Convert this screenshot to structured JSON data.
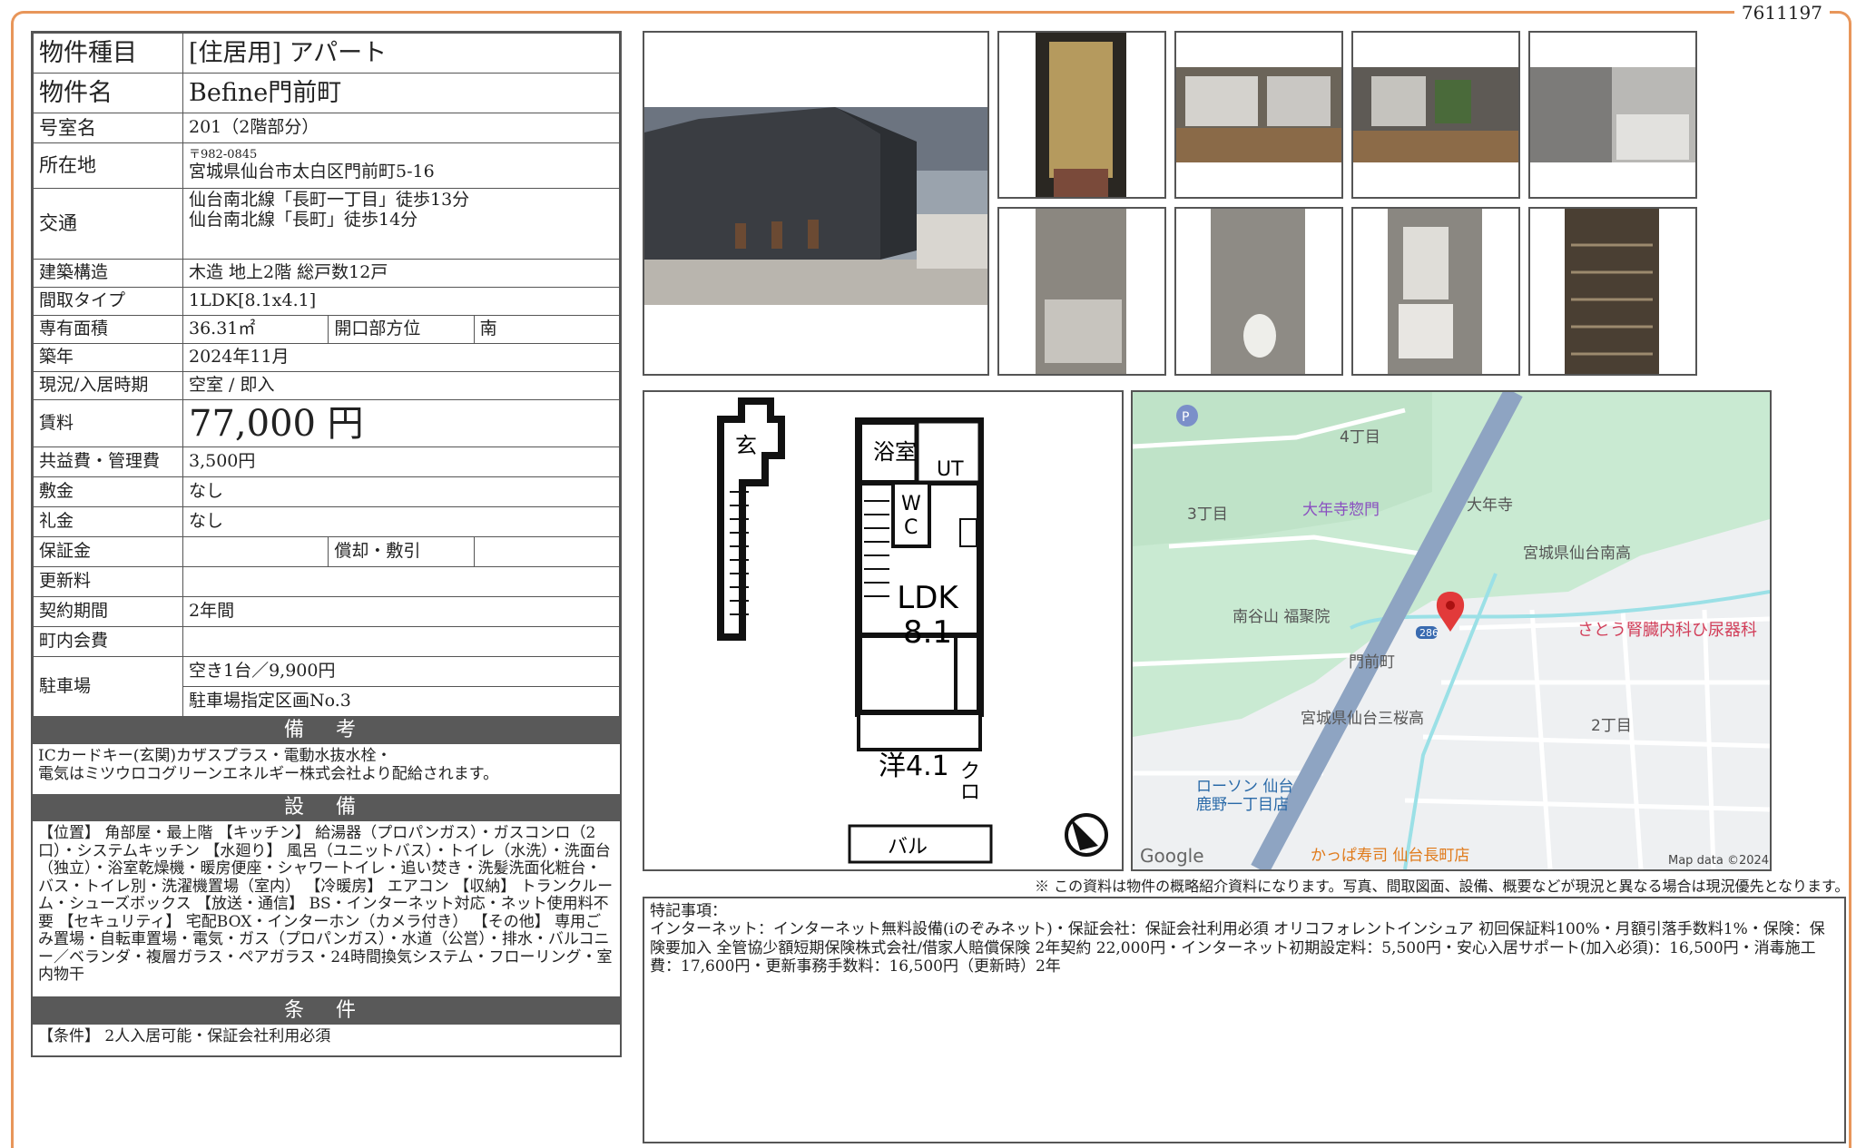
{
  "doc_id": "7611197",
  "property": {
    "type_label": "物件種目",
    "type_value": "[住居用] アパート",
    "name_label": "物件名",
    "name_value": "Befine門前町",
    "room_label": "号室名",
    "room_value": "201（2階部分）",
    "address_label": "所在地",
    "postal": "〒982-0845",
    "address": "宮城県仙台市太白区門前町5-16",
    "transit_label": "交通",
    "transit_1": "仙台南北線「長町一丁目」徒歩13分",
    "transit_2": "仙台南北線「長町」徒歩14分",
    "structure_label": "建築構造",
    "structure_value": "木造 地上2階 総戸数12戸",
    "layout_label": "間取タイプ",
    "layout_value": "1LDK[8.1x4.1]",
    "area_label": "専有面積",
    "area_value": "36.31㎡",
    "direction_label": "開口部方位",
    "direction_value": "南",
    "built_label": "築年",
    "built_value": "2024年11月",
    "status_label": "現況/入居時期",
    "status_value": "空室 / 即入",
    "rent_label": "賃料",
    "rent_value": "77,000 円",
    "fee_label": "共益費・管理費",
    "fee_value": "3,500円",
    "deposit_label": "敷金",
    "deposit_value": "なし",
    "key_label": "礼金",
    "key_value": "なし",
    "guarantee_label": "保証金",
    "amort_label": "償却・敷引",
    "renewal_label": "更新料",
    "contract_label": "契約期間",
    "contract_value": "2年間",
    "town_label": "町内会費",
    "parking_label": "駐車場",
    "parking_1": "空き1台／9,900円",
    "parking_2": "駐車場指定区画No.3"
  },
  "remarks": {
    "title": "備 考",
    "text": "ICカードキー(玄関)カザスプラス・電動水抜水栓・\n電気はミツウロコグリーンエネルギー株式会社より配給されます。"
  },
  "equipment": {
    "title": "設 備",
    "text": "【位置】 角部屋・最上階 【キッチン】 給湯器（プロパンガス）・ガスコンロ（2口）・システムキッチン 【水廻り】 風呂（ユニットバス）・トイレ（水洗）・洗面台（独立）・浴室乾燥機・暖房便座・シャワートイレ・追い焚き・洗髪洗面化粧台・バス・トイレ別・洗濯機置場（室内） 【冷暖房】 エアコン 【収納】 トランクルーム・シューズボックス 【放送・通信】 BS・インターネット対応・ネット使用料不要 【セキュリティ】 宅配BOX・インターホン（カメラ付き） 【その他】 専用ごみ置場・自転車置場・電気・ガス（プロパンガス）・水道（公営）・排水・バルコニー／ベランダ・複層ガラス・ペアガラス・24時間換気システム・フローリング・室内物干"
  },
  "conditions": {
    "title": "条 件",
    "text": "【条件】 2人入居可能・保証会社利用必須"
  },
  "floorplan": {
    "genkan": "玄",
    "bath": "浴室",
    "ut": "UT",
    "wc_w": "W",
    "wc_c": "C",
    "ldk": "LDK",
    "ldk_size": "8.1",
    "western": "洋4.1",
    "closet_1": "ク",
    "closet_2": "ロ",
    "balcony": "バル"
  },
  "map": {
    "l_4chome": "4丁目",
    "l_3chome": "3丁目",
    "l_2chome": "2丁目",
    "l_dainenji_mon": "大年寺惣門",
    "l_dainenji": "大年寺",
    "l_school1": "宮城県仙台南高",
    "l_fukujuin": "南谷山 福聚院",
    "l_monzen": "門前町",
    "l_clinic": "さとう腎臓内科ひ尿器科",
    "l_school2": "宮城県仙台三桜高",
    "l_lawson_1": "ローソン 仙台",
    "l_lawson_2": "鹿野一丁目店",
    "l_sushi": "かっぱ寿司 仙台長町店",
    "l_google": "Google",
    "l_mapdata": "Map data ©2024",
    "l_route": "286",
    "l_p": "P"
  },
  "note": "※ この資料は物件の概略紹介資料になります。写真、間取図面、設備、概要などが現況と異なる場合は現況優先となります。",
  "special": {
    "title": "特記事項：",
    "text": "インターネット：インターネット無料設備(iのぞみネット)・保証会社：保証会社利用必須 オリコフォレントインシュア 初回保証料100%・月額引落手数料1%・保険：保険要加入 全管協少額短期保険株式会社/借家人賠償保険 2年契約 22,000円・インターネット初期設定料：5,500円・安心入居サポート(加入必須)：16,500円・消毒施工費：17,600円・更新事務手数料：16,500円（更新時）2年"
  }
}
